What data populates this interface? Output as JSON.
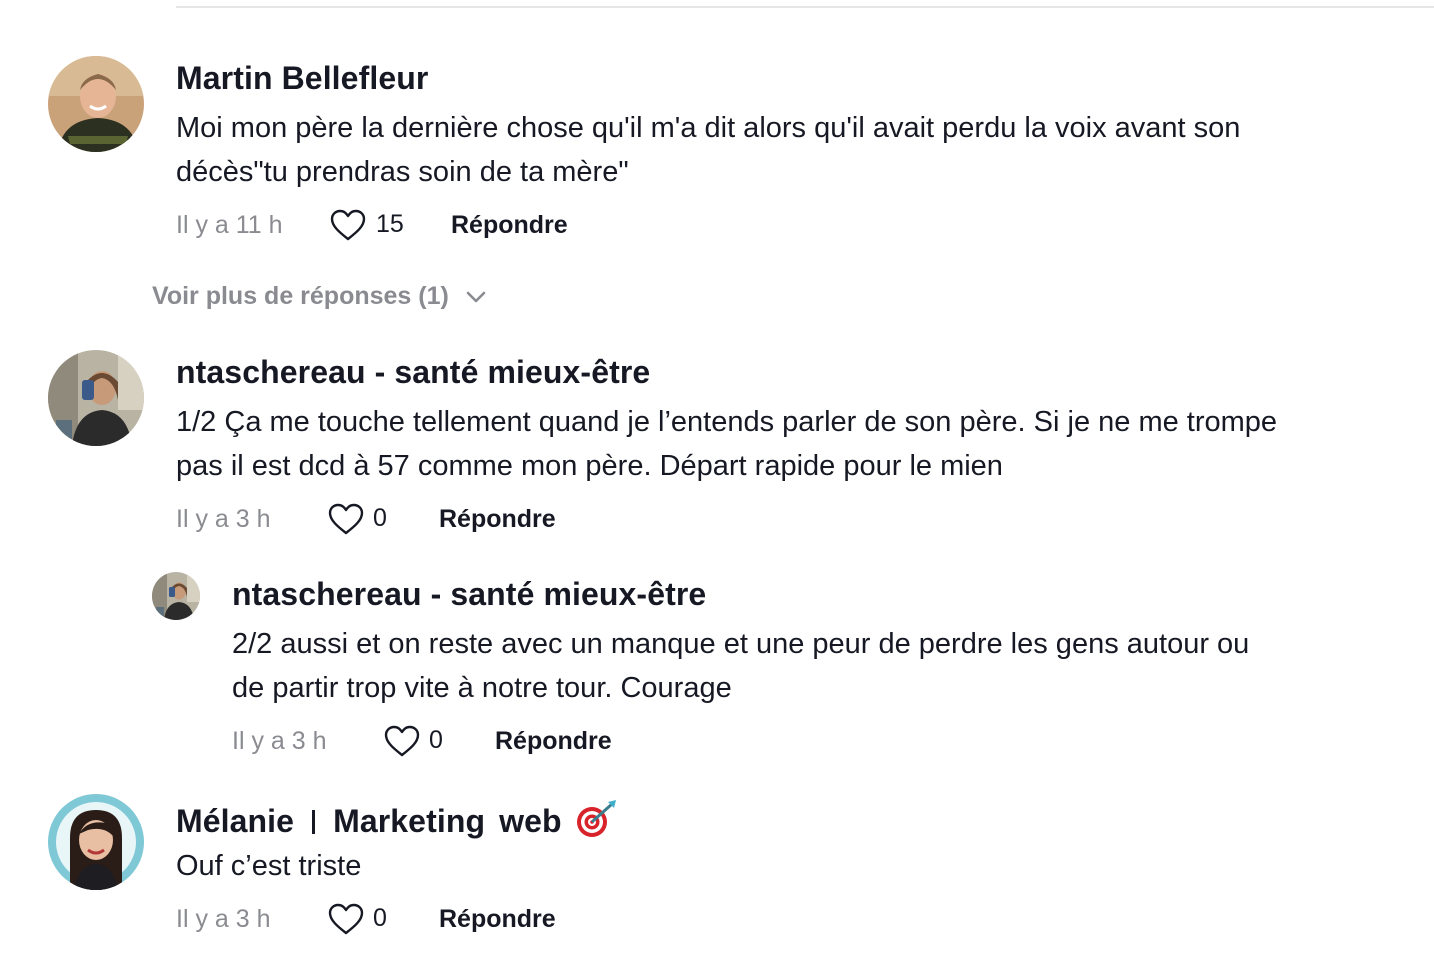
{
  "comments": [
    {
      "author": "Martin Bellefleur",
      "text_lines": [
        "Moi mon père la dernière chose qu'il m'a dit alors qu'il avait perdu la voix avant son",
        "décès\"tu prendras soin de ta mère\""
      ],
      "time": "Il y a 11 h",
      "likes": "15",
      "reply_label": "Répondre",
      "more_replies_label": "Voir plus de réponses (1)"
    },
    {
      "author": "ntaschereau - santé mieux-être",
      "text_lines": [
        "1/2 Ça me touche tellement quand je l’entends parler de son père. Si je ne me trompe",
        "pas il est dcd à 57 comme mon père. Départ rapide pour le mien"
      ],
      "time": "Il y a 3 h",
      "likes": "0",
      "reply_label": "Répondre"
    },
    {
      "author": "ntaschereau - santé mieux-être",
      "text_lines": [
        "2/2 aussi et on reste avec un manque et une peur de perdre les gens autour ou",
        "de partir trop vite à notre tour. Courage"
      ],
      "time": "Il y a 3 h",
      "likes": "0",
      "reply_label": "Répondre"
    },
    {
      "author_parts": [
        "Mélanie",
        "Marketing",
        "web"
      ],
      "author_emoji": "direct-hit-target-emoji",
      "text_lines": [
        "Ouf c’est triste"
      ],
      "time": "Il y a 3 h",
      "likes": "0",
      "reply_label": "Répondre"
    }
  ],
  "colors": {
    "text_primary": "#161823",
    "text_muted": "#8a8b91",
    "divider": "#e6e6e8"
  }
}
